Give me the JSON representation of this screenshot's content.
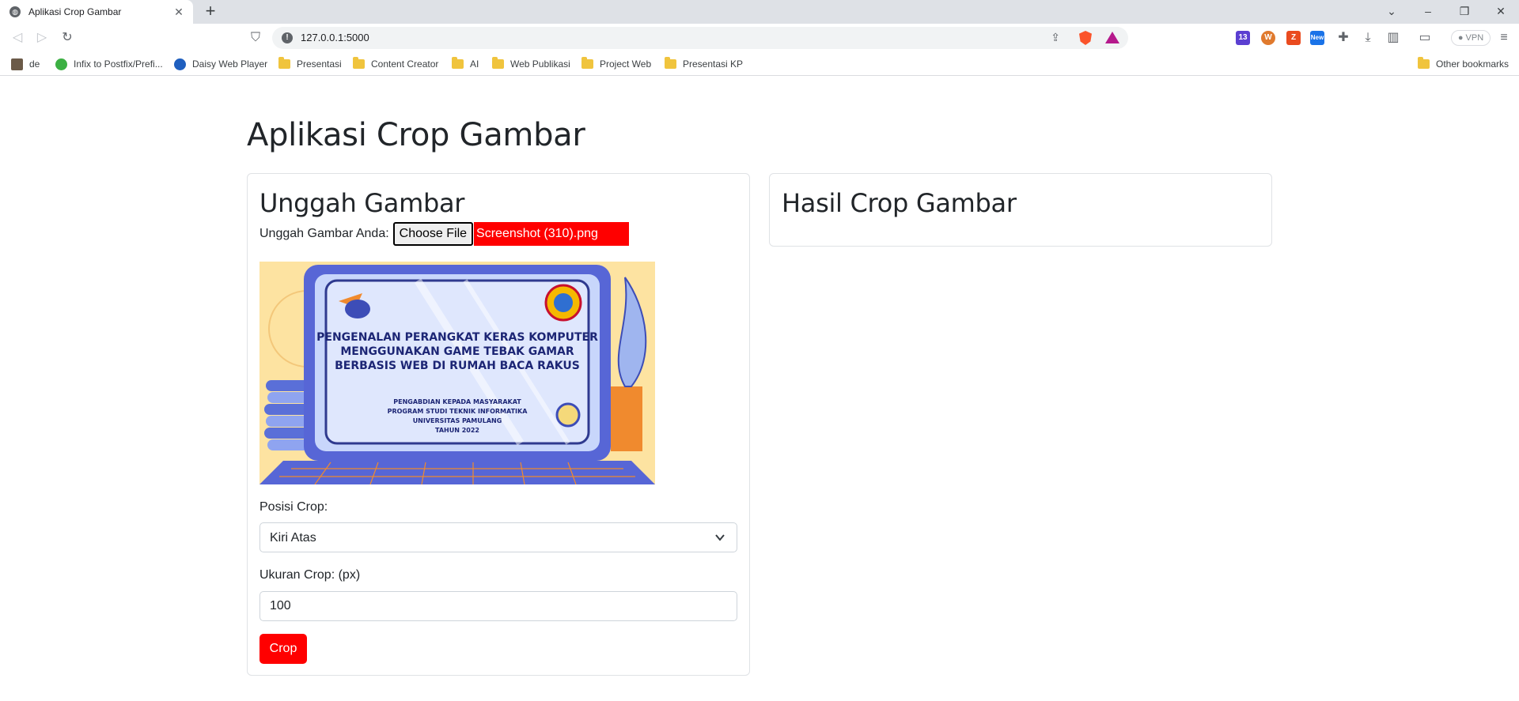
{
  "browser": {
    "tab_title": "Aplikasi Crop Gambar",
    "url": "127.0.0.1:5000",
    "vpn_label": "VPN",
    "ext_badge": "13",
    "ext_new_badge": "New",
    "bookmarks": [
      {
        "label": "de",
        "icon": "app-icon"
      },
      {
        "label": "Infix to Postfix/Prefi...",
        "icon": "site-icon"
      },
      {
        "label": "Daisy Web Player",
        "icon": "site-icon"
      },
      {
        "label": "Presentasi",
        "icon": "folder-icon"
      },
      {
        "label": "Content Creator",
        "icon": "folder-icon"
      },
      {
        "label": "AI",
        "icon": "folder-icon"
      },
      {
        "label": "Web Publikasi",
        "icon": "folder-icon"
      },
      {
        "label": "Project Web",
        "icon": "folder-icon"
      },
      {
        "label": "Presentasi KP",
        "icon": "folder-icon"
      }
    ],
    "other_bookmarks": "Other bookmarks"
  },
  "page": {
    "title": "Aplikasi Crop Gambar",
    "upload_card": {
      "heading": "Unggah Gambar",
      "upload_label": "Unggah Gambar Anda:",
      "file_button": "Choose File",
      "file_name": "Screenshot (310).png",
      "preview": {
        "line1": "PENGENALAN PERANGKAT KERAS KOMPUTER",
        "line2": "MENGGUNAKAN GAME TEBAK GAMAR",
        "line3": "BERBASIS WEB DI RUMAH BACA RAKUS",
        "sub1": "PENGABDIAN KEPADA MASYARAKAT",
        "sub2": "PROGRAM STUDI TEKNIK INFORMATIKA",
        "sub3": "UNIVERSITAS PAMULANG",
        "sub4": "TAHUN 2022"
      },
      "position_label": "Posisi Crop:",
      "position_value": "Kiri Atas",
      "size_label": "Ukuran Crop: (px)",
      "size_value": "100",
      "crop_button": "Crop"
    },
    "result_card": {
      "heading": "Hasil Crop Gambar"
    }
  },
  "colors": {
    "accent": "#ff0000",
    "text": "#212529",
    "border": "#dfe2e5"
  }
}
